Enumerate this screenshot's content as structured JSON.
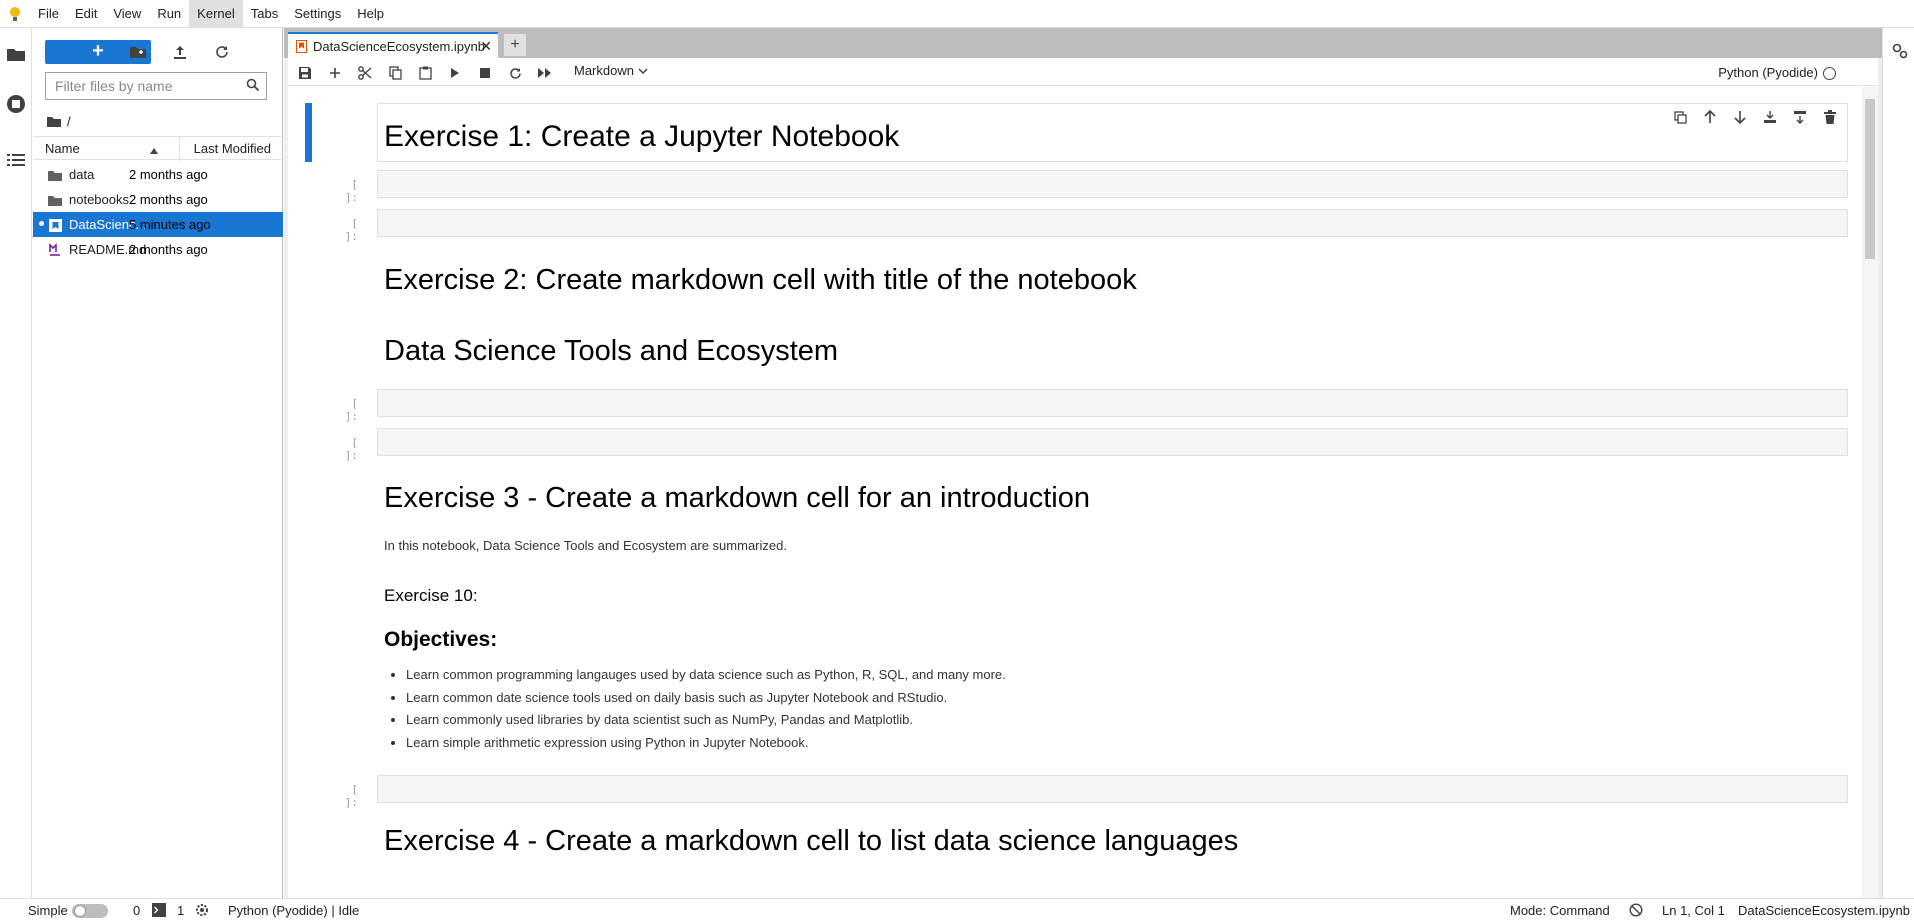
{
  "menubar": {
    "items": [
      "File",
      "Edit",
      "View",
      "Run",
      "Kernel",
      "Tabs",
      "Settings",
      "Help"
    ],
    "active_index": 4
  },
  "filebrowser": {
    "new_label": "+",
    "filter_placeholder": "Filter files by name",
    "path": "/",
    "columns": {
      "name": "Name",
      "modified": "Last Modified"
    },
    "files": [
      {
        "name": "data",
        "modified": "2 months ago",
        "icon": "folder-icon"
      },
      {
        "name": "notebooks",
        "modified": "2 months ago",
        "icon": "folder-icon"
      },
      {
        "name": "DataScienc...",
        "modified": "5 minutes ago",
        "icon": "notebook-icon"
      },
      {
        "name": "README.md",
        "modified": "2 months ago",
        "icon": "markdown-icon"
      }
    ]
  },
  "tab": {
    "title": "DataScienceEcosystem.ipynb",
    "close": "✕",
    "add": "+"
  },
  "toolbar": {
    "cell_type": "Markdown",
    "kernel": "Python (Pyodide)"
  },
  "cells": {
    "h_ex1": "Exercise 1: Create a Jupyter Notebook",
    "prompt_empty": "[ ]:",
    "h_ex2": "Exercise 2: Create markdown cell with title of the notebook",
    "h_title": "Data Science Tools and Ecosystem",
    "h_ex3": "Exercise 3 - Create a markdown cell for an introduction",
    "intro": "In this notebook, Data Science Tools and Ecosystem are summarized.",
    "ex10": "Exercise 10:",
    "objectives": "Objectives:",
    "bullets": [
      "Learn common programming langauges used by data science such as Python, R, SQL, and many more.",
      "Learn common date science tools used on daily basis such as Jupyter Notebook and RStudio.",
      "Learn commonly used libraries by data scientist such as NumPy, Pandas and Matplotlib.",
      "Learn simple arithmetic expression using Python in Jupyter Notebook."
    ],
    "h_ex4": "Exercise 4 - Create a markdown cell to list data science languages"
  },
  "statusbar": {
    "simple": "Simple",
    "terminals": "0",
    "kernels": "1",
    "kernel_status": "Python (Pyodide) | Idle",
    "mode": "Mode: Command",
    "position": "Ln 1, Col 1",
    "filename": "DataScienceEcosystem.ipynb"
  },
  "colors": {
    "accent": "#1976d2",
    "background": "#eeeeee",
    "cell": "#f5f5f5"
  }
}
